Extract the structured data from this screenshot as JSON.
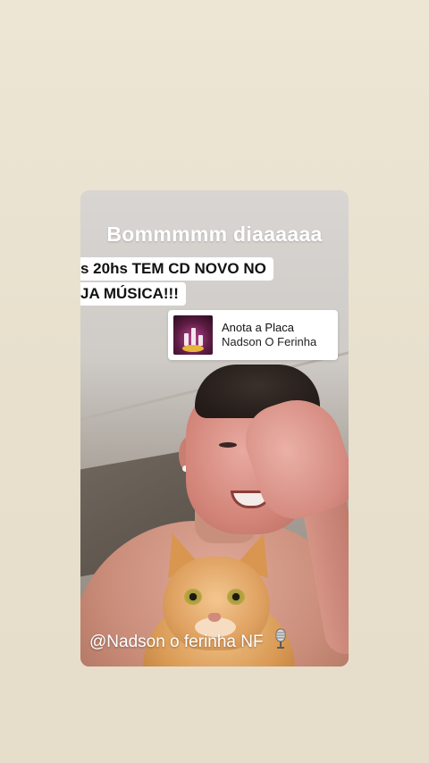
{
  "story": {
    "headline": "Bommmmm diaaaaaa",
    "caption_line_1": "s 20hs TEM CD NOVO NO",
    "caption_line_2": "JA MÚSICA!!!",
    "music_sticker": {
      "song_title": "Anota a Placa",
      "artist": "Nadson O Ferinha"
    },
    "user_tag": "@Nadson o ferinha NF",
    "user_tag_icon": "microphone-icon"
  },
  "colors": {
    "background": "#e9e1cf",
    "caption_bg": "#ffffff",
    "headline_text": "#ffffff"
  }
}
